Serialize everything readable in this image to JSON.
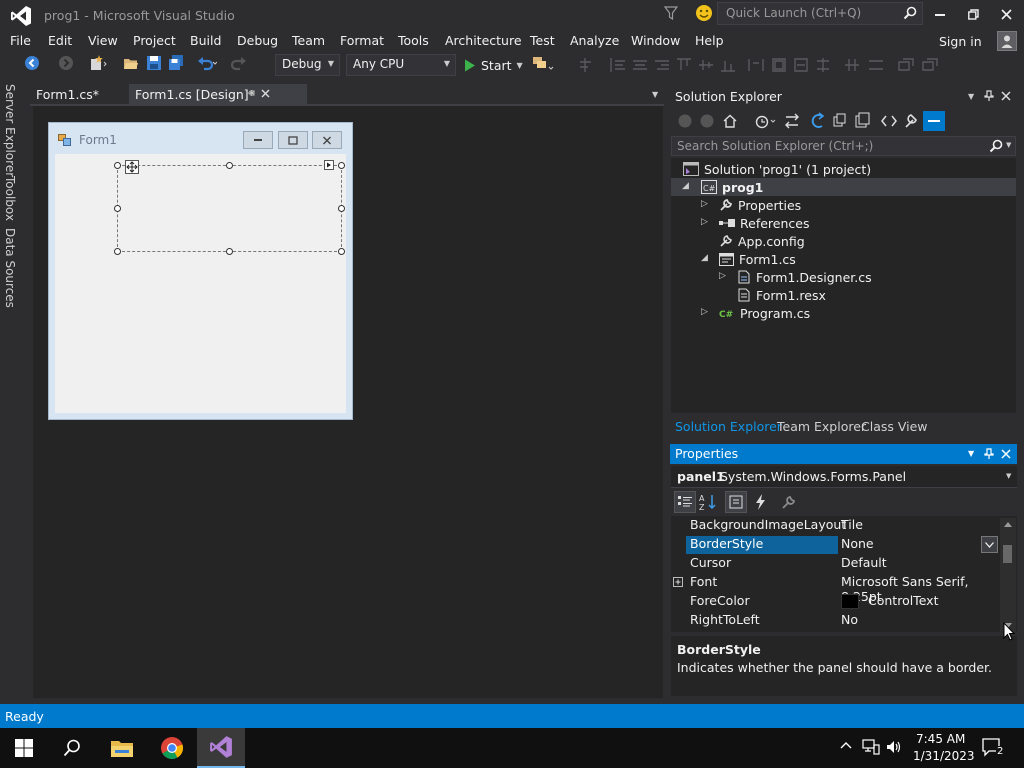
{
  "window": {
    "title": "prog1 - Microsoft Visual Studio",
    "quick_launch_placeholder": "Quick Launch (Ctrl+Q)",
    "sign_in": "Sign in"
  },
  "menu": [
    "File",
    "Edit",
    "View",
    "Project",
    "Build",
    "Debug",
    "Team",
    "Format",
    "Tools",
    "Architecture",
    "Test",
    "Analyze",
    "Window",
    "Help"
  ],
  "toolbar": {
    "config": "Debug",
    "platform": "Any CPU",
    "start": "Start"
  },
  "side_tabs": [
    "Server Explorer",
    "Toolbox",
    "Data Sources"
  ],
  "doc_tabs": [
    {
      "label": "Form1.cs*",
      "active": false
    },
    {
      "label": "Form1.cs [Design]*",
      "active": true
    }
  ],
  "designer": {
    "form_title": "Form1"
  },
  "solution_explorer": {
    "title": "Solution Explorer",
    "search_placeholder": "Search Solution Explorer (Ctrl+;)",
    "tree": [
      {
        "label": "Solution 'prog1' (1 project)",
        "icon": "solution-icon"
      },
      {
        "label": "prog1",
        "icon": "csharp-project-icon",
        "expanded": true,
        "bold": true
      },
      {
        "label": "Properties",
        "icon": "wrench-icon",
        "expanded": false
      },
      {
        "label": "References",
        "icon": "references-icon",
        "expanded": false
      },
      {
        "label": "App.config",
        "icon": "config-file-icon"
      },
      {
        "label": "Form1.cs",
        "icon": "form-file-icon",
        "expanded": true
      },
      {
        "label": "Form1.Designer.cs",
        "icon": "cs-file-icon",
        "expanded": false
      },
      {
        "label": "Form1.resx",
        "icon": "resx-file-icon"
      },
      {
        "label": "Program.cs",
        "icon": "csharp-file-icon",
        "expanded": false
      }
    ],
    "bottom_tabs": [
      "Solution Explorer",
      "Team Explorer",
      "Class View"
    ]
  },
  "properties": {
    "title": "Properties",
    "object_name": "panel1",
    "object_type": "System.Windows.Forms.Panel",
    "rows": [
      {
        "name": "BackgroundImageLayout",
        "value": "Tile"
      },
      {
        "name": "BorderStyle",
        "value": "None",
        "selected": true
      },
      {
        "name": "Cursor",
        "value": "Default"
      },
      {
        "name": "Font",
        "value": "Microsoft Sans Serif, 8.25pt",
        "expandable": true
      },
      {
        "name": "ForeColor",
        "value": "ControlText",
        "swatch": "#000000"
      },
      {
        "name": "RightToLeft",
        "value": "No"
      }
    ],
    "description_title": "BorderStyle",
    "description_text": "Indicates whether the panel should have a border."
  },
  "status": "Ready",
  "taskbar": {
    "time": "7:45 AM",
    "date": "1/31/2023",
    "notification_count": "2"
  },
  "colors": {
    "accent": "#007acc",
    "background": "#2d2d30",
    "panel": "#252526",
    "selection": "#0e639c"
  }
}
